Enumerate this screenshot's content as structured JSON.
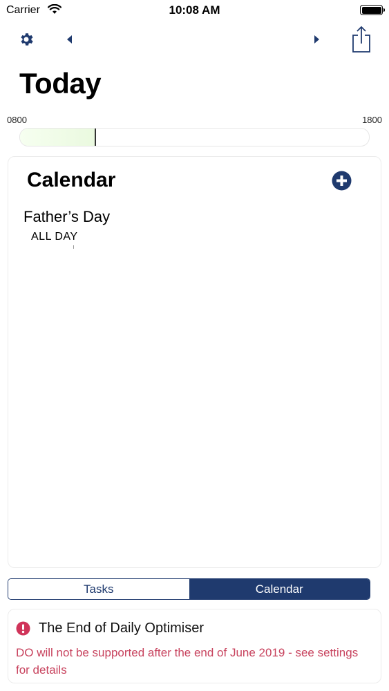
{
  "status_bar": {
    "carrier": "Carrier",
    "time": "10:08 AM"
  },
  "nav": {
    "settings_icon": "gear-icon",
    "prev_icon": "chevron-left-icon",
    "next_icon": "chevron-right-icon",
    "share_icon": "share-icon"
  },
  "header": {
    "title": "Today"
  },
  "timeline": {
    "start_label": "0800",
    "end_label": "1800",
    "progress_fraction": 0.215
  },
  "calendar": {
    "title": "Calendar",
    "add_icon": "plus-circle-icon",
    "events": [
      {
        "title": "Father’s Day",
        "time": "ALL DAY"
      }
    ]
  },
  "segmented_control": {
    "options": [
      "Tasks",
      "Calendar"
    ],
    "selected": "Calendar"
  },
  "notice": {
    "icon": "alert-circle-icon",
    "title": "The End of Daily Optimiser",
    "body": "DO will not be supported after the end of June 2019 - see settings for details"
  },
  "colors": {
    "accent": "#1f3a6e",
    "notice_text": "#c8435e",
    "alert_icon": "#d0345a"
  }
}
